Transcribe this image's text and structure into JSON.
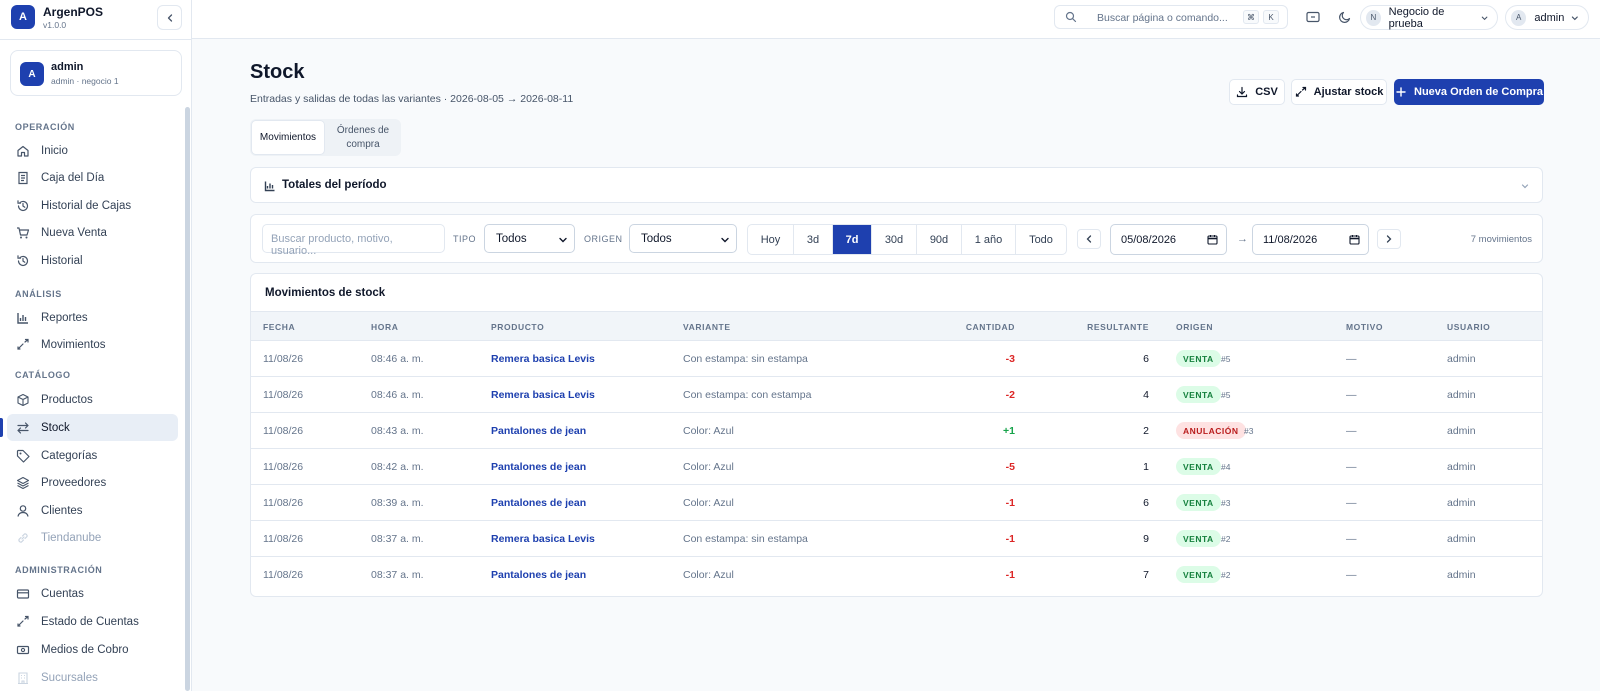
{
  "app": {
    "name": "ArgenPOS",
    "version": "v1.0.0",
    "logo_letter": "A"
  },
  "user_card": {
    "avatar": "A",
    "name": "admin",
    "sub": "admin · negocio 1"
  },
  "sidebar": {
    "sections": [
      {
        "label": "OPERACIÓN",
        "items": [
          {
            "label": "Inicio",
            "icon": "home-icon"
          },
          {
            "label": "Caja del Día",
            "icon": "receipt-icon"
          },
          {
            "label": "Historial de Cajas",
            "icon": "history-icon"
          },
          {
            "label": "Nueva Venta",
            "icon": "cart-icon"
          },
          {
            "label": "Historial",
            "icon": "history-icon"
          }
        ]
      },
      {
        "label": "ANÁLISIS",
        "items": [
          {
            "label": "Reportes",
            "icon": "bar-chart-icon"
          },
          {
            "label": "Movimientos",
            "icon": "trend-arrows-icon"
          }
        ]
      },
      {
        "label": "CATÁLOGO",
        "items": [
          {
            "label": "Productos",
            "icon": "box-icon"
          },
          {
            "label": "Stock",
            "icon": "swap-icon",
            "active": true
          },
          {
            "label": "Categorías",
            "icon": "tag-icon"
          },
          {
            "label": "Proveedores",
            "icon": "layers-icon"
          },
          {
            "label": "Clientes",
            "icon": "person-icon"
          },
          {
            "label": "Tiendanube",
            "icon": "link-icon",
            "disabled": true
          }
        ]
      },
      {
        "label": "ADMINISTRACIÓN",
        "items": [
          {
            "label": "Cuentas",
            "icon": "card-icon"
          },
          {
            "label": "Estado de Cuentas",
            "icon": "trend-arrows-icon"
          },
          {
            "label": "Medios de Cobro",
            "icon": "cash-icon"
          },
          {
            "label": "Sucursales",
            "icon": "building-icon",
            "disabled": true
          }
        ]
      }
    ]
  },
  "topbar": {
    "search_placeholder": "Buscar página o comando...",
    "kbd1": "⌘",
    "kbd2": "K",
    "business": "Negocio de prueba",
    "business_avatar": "N",
    "user": "admin",
    "user_avatar": "A"
  },
  "page": {
    "title": "Stock",
    "subtitle": "Entradas y salidas de todas las variantes · 2026-08-05 → 2026-08-11",
    "btn_csv": "CSV",
    "btn_adjust": "Ajustar stock",
    "btn_new_po": "Nueva Orden de Compra",
    "tab_movements": "Movimientos",
    "tab_orders": "Órdenes de compra",
    "totals_label": "Totales del período"
  },
  "filters": {
    "search_placeholder": "Buscar producto, motivo, usuario...",
    "tipo_label": "TIPO",
    "tipo_value": "Todos",
    "origen_label": "ORIGEN",
    "origen_value": "Todos",
    "ranges": [
      "Hoy",
      "3d",
      "7d",
      "30d",
      "90d",
      "1 año",
      "Todo"
    ],
    "active_range": "7d",
    "date_from": "05/08/2026",
    "date_to": "11/08/2026",
    "arrow": "→",
    "count": "7 movimientos"
  },
  "table": {
    "title": "Movimientos de stock",
    "columns": [
      "FECHA",
      "HORA",
      "PRODUCTO",
      "VARIANTE",
      "CANTIDAD",
      "RESULTANTE",
      "ORIGEN",
      "MOTIVO",
      "USUARIO"
    ],
    "rows": [
      {
        "fecha": "11/08/26",
        "hora": "08:46 a. m.",
        "producto": "Remera basica Levis",
        "variante": "Con estampa: sin estampa",
        "cantidad": "-3",
        "resultante": "6",
        "origen": "VENTA",
        "ref": "#5",
        "motivo": "—",
        "usuario": "admin"
      },
      {
        "fecha": "11/08/26",
        "hora": "08:46 a. m.",
        "producto": "Remera basica Levis",
        "variante": "Con estampa: con estampa",
        "cantidad": "-2",
        "resultante": "4",
        "origen": "VENTA",
        "ref": "#5",
        "motivo": "—",
        "usuario": "admin"
      },
      {
        "fecha": "11/08/26",
        "hora": "08:43 a. m.",
        "producto": "Pantalones de jean",
        "variante": "Color: Azul",
        "cantidad": "+1",
        "resultante": "2",
        "origen": "ANULACIÓN",
        "ref": "#3",
        "motivo": "—",
        "usuario": "admin"
      },
      {
        "fecha": "11/08/26",
        "hora": "08:42 a. m.",
        "producto": "Pantalones de jean",
        "variante": "Color: Azul",
        "cantidad": "-5",
        "resultante": "1",
        "origen": "VENTA",
        "ref": "#4",
        "motivo": "—",
        "usuario": "admin"
      },
      {
        "fecha": "11/08/26",
        "hora": "08:39 a. m.",
        "producto": "Pantalones de jean",
        "variante": "Color: Azul",
        "cantidad": "-1",
        "resultante": "6",
        "origen": "VENTA",
        "ref": "#3",
        "motivo": "—",
        "usuario": "admin"
      },
      {
        "fecha": "11/08/26",
        "hora": "08:37 a. m.",
        "producto": "Remera basica Levis",
        "variante": "Con estampa: sin estampa",
        "cantidad": "-1",
        "resultante": "9",
        "origen": "VENTA",
        "ref": "#2",
        "motivo": "—",
        "usuario": "admin"
      },
      {
        "fecha": "11/08/26",
        "hora": "08:37 a. m.",
        "producto": "Pantalones de jean",
        "variante": "Color: Azul",
        "cantidad": "-1",
        "resultante": "7",
        "origen": "VENTA",
        "ref": "#2",
        "motivo": "—",
        "usuario": "admin"
      }
    ]
  },
  "colors": {
    "accent": "#1e40af",
    "negative": "#dc2626",
    "positive": "#16a34a",
    "venta_bg": "#dcfce7",
    "anulacion_bg": "#fee2e2"
  }
}
